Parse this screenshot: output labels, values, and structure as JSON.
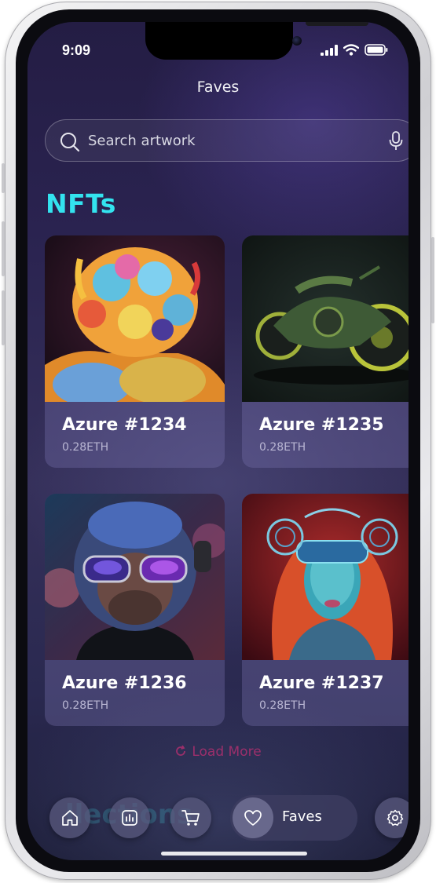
{
  "status_bar": {
    "time": "9:09"
  },
  "header": {
    "title": "Faves"
  },
  "search": {
    "placeholder": "Search artwork"
  },
  "section": {
    "title": "NFTs"
  },
  "nfts": [
    {
      "name": "Azure #1234",
      "price": "0.28ETH"
    },
    {
      "name": "Azure #1235",
      "price": "0.28ETH"
    },
    {
      "name": "Azure #1236",
      "price": "0.28ETH"
    },
    {
      "name": "Azure #1237",
      "price": "0.28ETH"
    }
  ],
  "load_more": {
    "label": "Load More"
  },
  "ghost_section": {
    "title": "llections"
  },
  "bottom_nav": {
    "items": [
      {
        "icon": "home-icon"
      },
      {
        "icon": "chart-icon"
      },
      {
        "icon": "cart-icon"
      },
      {
        "icon": "heart-icon",
        "label": "Faves",
        "active": true
      },
      {
        "icon": "gear-icon"
      }
    ]
  },
  "colors": {
    "accent": "#33e3ef",
    "load_more": "#9c2f6b"
  }
}
